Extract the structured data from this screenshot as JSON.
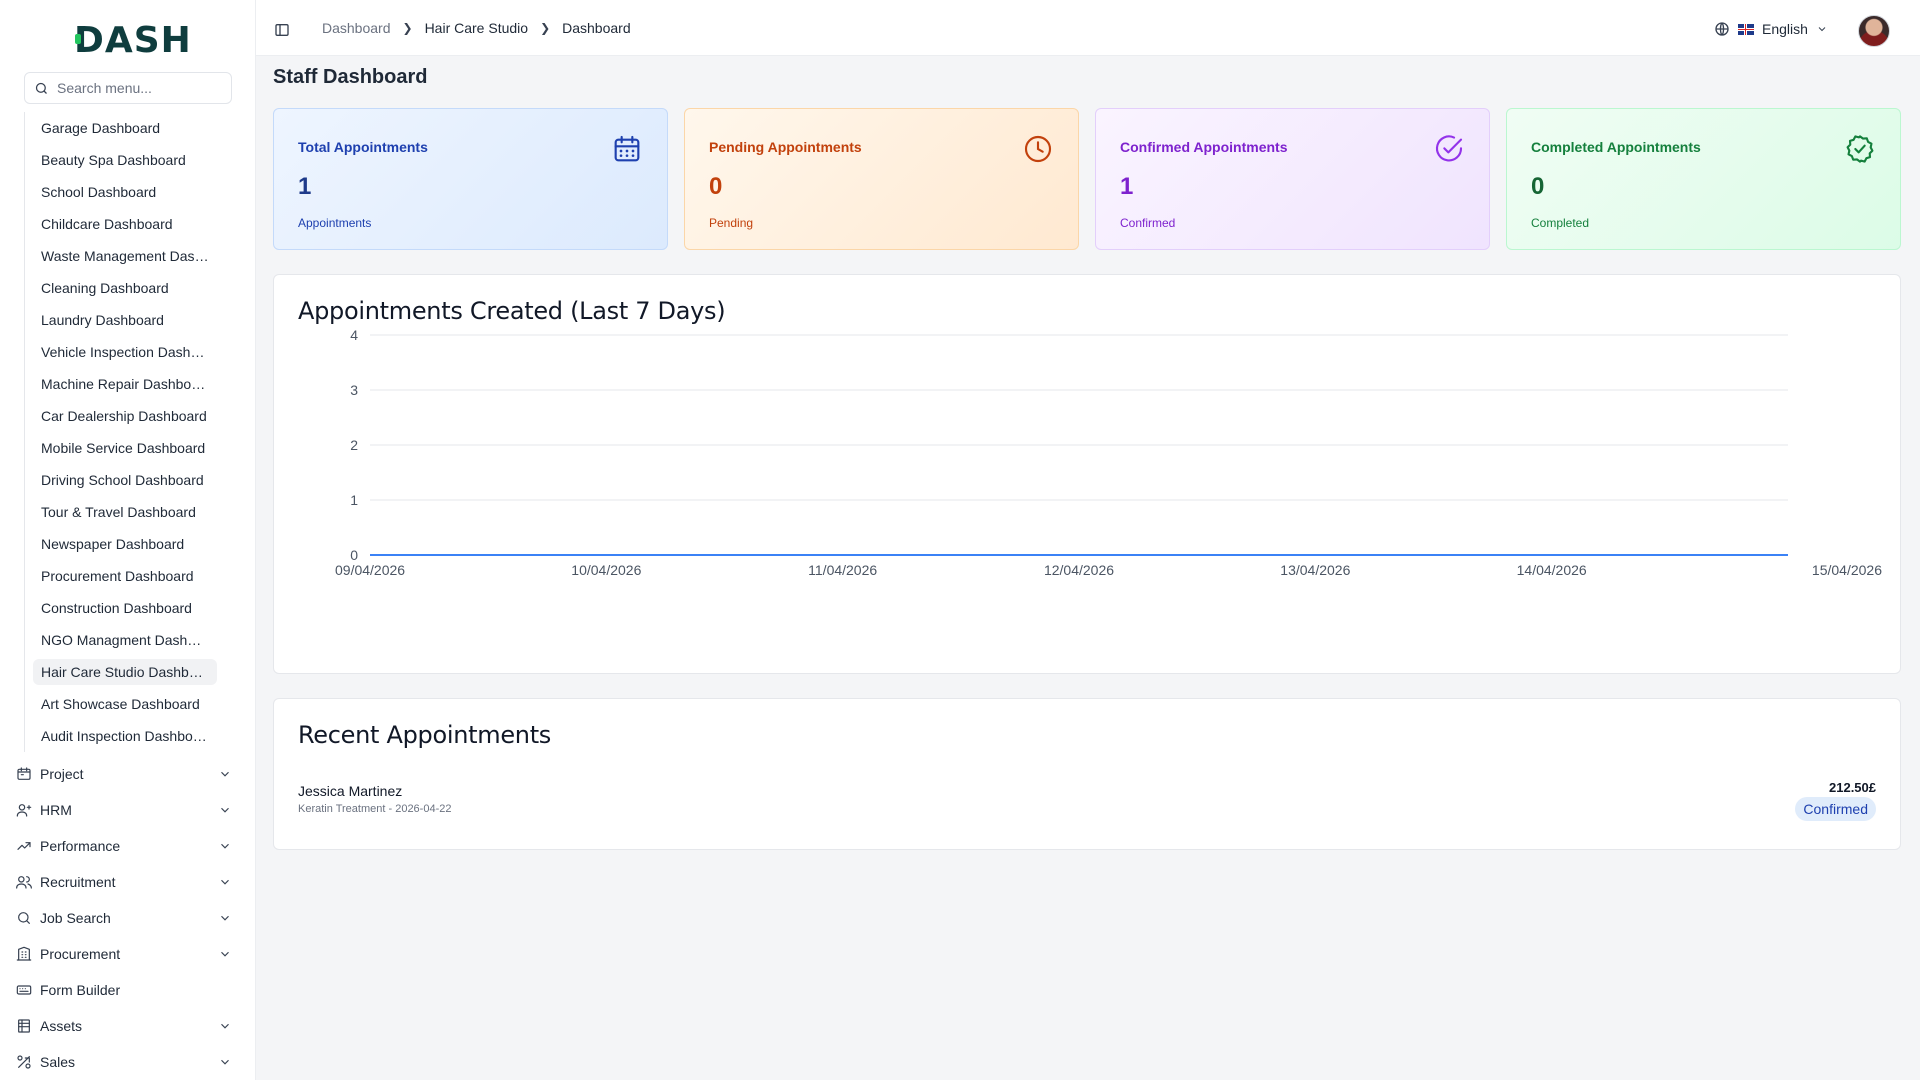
{
  "brand": {
    "logo_text": "DASH"
  },
  "sidebar": {
    "search_placeholder": "Search menu...",
    "sub_items": [
      "Garage Dashboard",
      "Beauty Spa Dashboard",
      "School Dashboard",
      "Childcare Dashboard",
      "Waste Management Dashboard",
      "Cleaning Dashboard",
      "Laundry Dashboard",
      "Vehicle Inspection Dashboard",
      "Machine Repair Dashboard",
      "Car Dealership Dashboard",
      "Mobile Service Dashboard",
      "Driving School Dashboard",
      "Tour & Travel Dashboard",
      "Newspaper Dashboard",
      "Procurement Dashboard",
      "Construction Dashboard",
      "NGO Managment Dashboard",
      "Hair Care Studio Dashboard",
      "Art Showcase Dashboard",
      "Audit Inspection Dashboard"
    ],
    "active_sub_item": "Hair Care Studio Dashboard",
    "nav_items": [
      {
        "label": "Project",
        "icon": "project-icon",
        "has_children": true
      },
      {
        "label": "HRM",
        "icon": "users-icon",
        "has_children": true
      },
      {
        "label": "Performance",
        "icon": "trend-icon",
        "has_children": true
      },
      {
        "label": "Recruitment",
        "icon": "recruit-icon",
        "has_children": true
      },
      {
        "label": "Job Search",
        "icon": "search-icon",
        "has_children": true
      },
      {
        "label": "Procurement",
        "icon": "building-icon",
        "has_children": true
      },
      {
        "label": "Form Builder",
        "icon": "form-icon",
        "has_children": false
      },
      {
        "label": "Assets",
        "icon": "assets-icon",
        "has_children": true
      },
      {
        "label": "Sales",
        "icon": "sales-icon",
        "has_children": true
      }
    ]
  },
  "topbar": {
    "breadcrumb": [
      "Dashboard",
      "Hair Care Studio",
      "Dashboard"
    ],
    "language": "English"
  },
  "page": {
    "title": "Staff Dashboard"
  },
  "stats": [
    {
      "title": "Total Appointments",
      "value": "1",
      "sub": "Appointments",
      "icon": "calendar-icon",
      "color": "#1e40af"
    },
    {
      "title": "Pending Appointments",
      "value": "0",
      "sub": "Pending",
      "icon": "clock-icon",
      "color": "#c2410c"
    },
    {
      "title": "Confirmed Appointments",
      "value": "1",
      "sub": "Confirmed",
      "icon": "check-circle-icon",
      "color": "#9333ea"
    },
    {
      "title": "Completed Appointments",
      "value": "0",
      "sub": "Completed",
      "icon": "badge-check-icon",
      "color": "#15803d"
    }
  ],
  "chart_data": {
    "type": "line",
    "title": "Appointments Created (Last 7 Days)",
    "categories": [
      "09/04/2026",
      "10/04/2026",
      "11/04/2026",
      "12/04/2026",
      "13/04/2026",
      "14/04/2026",
      "15/04/2026"
    ],
    "series": [
      {
        "values": [
          0,
          0,
          0,
          0,
          0,
          0,
          0
        ]
      }
    ],
    "ylim": [
      0,
      4
    ],
    "yticks": [
      0,
      1,
      2,
      3,
      4
    ],
    "grid": true,
    "line_color": "#3b82f6"
  },
  "recent": {
    "title": "Recent Appointments",
    "items": [
      {
        "name": "Jessica Martinez",
        "meta": "Keratin Treatment - 2026-04-22",
        "price": "212.50£",
        "status": "Confirmed"
      }
    ]
  }
}
